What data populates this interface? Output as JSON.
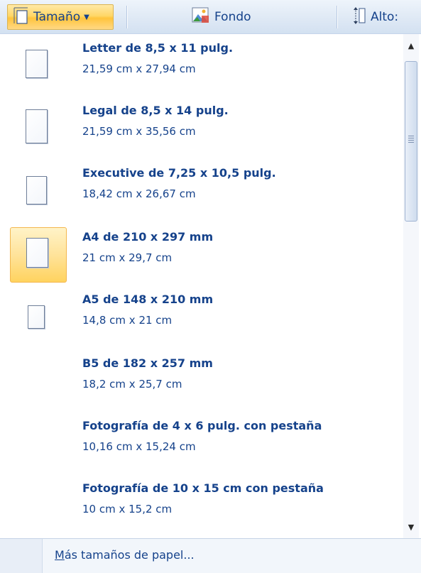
{
  "ribbon": {
    "size_button": {
      "label": "Tamaño",
      "icon": "page-size-icon"
    },
    "background_button": {
      "label": "Fondo",
      "icon": "page-background-icon"
    },
    "height_control": {
      "label": "Alto:",
      "icon": "height-icon"
    }
  },
  "paper_sizes": [
    {
      "title": "Letter de 8,5 x 11 pulg.",
      "dims": "21,59 cm x 27,94 cm",
      "selected": false
    },
    {
      "title": "Legal de 8,5 x 14 pulg.",
      "dims": "21,59 cm x 35,56 cm",
      "selected": false
    },
    {
      "title": "Executive de 7,25 x 10,5 pulg.",
      "dims": "18,42 cm x 26,67 cm",
      "selected": false
    },
    {
      "title": "A4 de 210 x 297 mm",
      "dims": "21 cm x 29,7 cm",
      "selected": true
    },
    {
      "title": "A5 de 148 x 210 mm",
      "dims": "14,8 cm x 21 cm",
      "selected": false
    },
    {
      "title": "B5 de 182 x 257 mm",
      "dims": "18,2 cm x 25,7 cm",
      "selected": false
    },
    {
      "title": "Fotografía de 4 x 6 pulg. con pestaña",
      "dims": "10,16 cm x 15,24 cm",
      "selected": false
    },
    {
      "title": "Fotografía de 10 x 15 cm con pestaña",
      "dims": "10 cm x 15,2 cm",
      "selected": false
    }
  ],
  "footer": {
    "more_sizes_accel": "M",
    "more_sizes_rest": "ás tamaños de papel..."
  },
  "colors": {
    "text": "#15428b",
    "selected_highlight": "#ffd768",
    "ribbon_bg": "#dfe9f5"
  }
}
